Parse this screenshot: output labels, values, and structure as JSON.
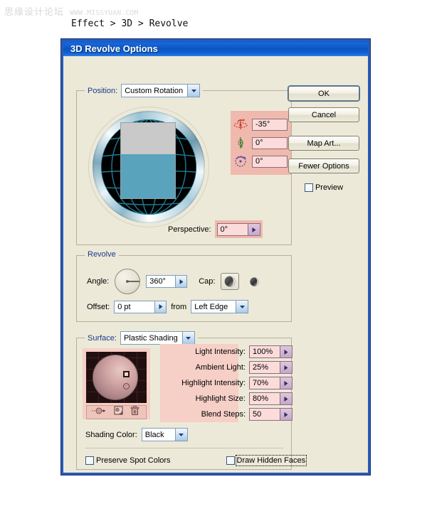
{
  "watermark": {
    "cn": "思缘设计论坛",
    "url": "WWW.MISSYUAN.COM"
  },
  "caption": "Effect > 3D > Revolve",
  "dialog": {
    "title": "3D Revolve Options",
    "position_group": {
      "label": "Position:",
      "preset": "Custom Rotation",
      "rotations": [
        {
          "axis": "x-rotation-icon",
          "value": "-35°"
        },
        {
          "axis": "y-rotation-icon",
          "value": "0°"
        },
        {
          "axis": "z-rotation-icon",
          "value": "0°"
        }
      ],
      "perspective_label": "Perspective:",
      "perspective_value": "0°"
    },
    "revolve_group": {
      "title": "Revolve",
      "angle_label": "Angle:",
      "angle_value": "360°",
      "cap_label": "Cap:",
      "cap_options": [
        "cap-on-icon",
        "cap-off-icon"
      ],
      "cap_selected": 0,
      "offset_label": "Offset:",
      "offset_value": "0 pt",
      "from_label": "from",
      "from_value": "Left Edge"
    },
    "surface_group": {
      "label": "Surface:",
      "shading": "Plastic Shading",
      "lighting": [
        {
          "label": "Light Intensity:",
          "value": "100%"
        },
        {
          "label": "Ambient Light:",
          "value": "25%"
        },
        {
          "label": "Highlight Intensity:",
          "value": "70%"
        },
        {
          "label": "Highlight Size:",
          "value": "80%"
        },
        {
          "label": "Blend Steps:",
          "value": "50"
        }
      ],
      "shading_color_label": "Shading Color:",
      "shading_color_value": "Black",
      "preserve_spot_colors": "Preserve Spot Colors",
      "draw_hidden_faces": "Draw Hidden Faces"
    },
    "buttons": {
      "ok": "OK",
      "cancel": "Cancel",
      "map_art": "Map Art...",
      "fewer_options": "Fewer Options",
      "preview": "Preview"
    }
  },
  "colors": {
    "accent_blue": "#2a5bb8",
    "dialog_bg": "#ece9d8",
    "highlight_pink": "#f0b9ad",
    "field_pink": "#fbdcdb",
    "teal": "#59a3bc",
    "gray": "#c9c9c9"
  }
}
